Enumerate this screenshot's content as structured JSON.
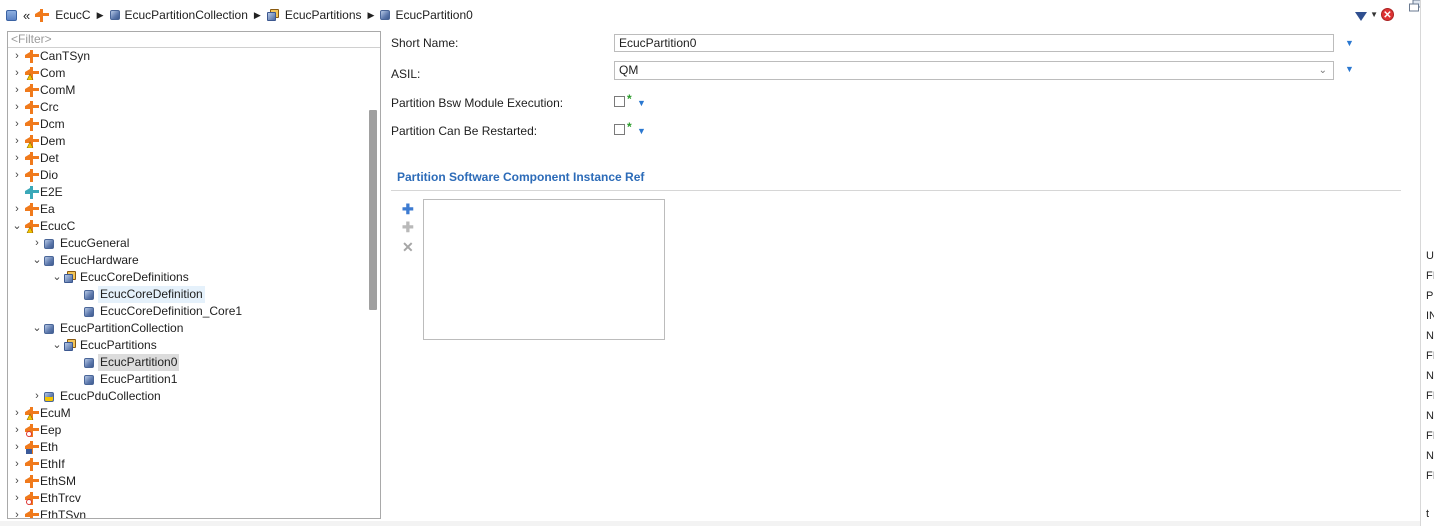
{
  "breadcrumb": {
    "items": [
      "EcucC",
      "EcucPartitionCollection",
      "EcucPartitions",
      "EcucPartition0"
    ],
    "back_symbol": "«",
    "separator": "▶",
    "close_symbol": "✕"
  },
  "tree": {
    "filter_placeholder": "<Filter>",
    "rows": [
      {
        "label": "CanTSyn",
        "level": 0,
        "icon": "module-icon",
        "toggle": "›"
      },
      {
        "label": "Com",
        "level": 0,
        "icon": "module-warning-icon",
        "toggle": "›"
      },
      {
        "label": "ComM",
        "level": 0,
        "icon": "module-icon",
        "toggle": "›"
      },
      {
        "label": "Crc",
        "level": 0,
        "icon": "module-icon",
        "toggle": "›"
      },
      {
        "label": "Dcm",
        "level": 0,
        "icon": "module-icon",
        "toggle": "›"
      },
      {
        "label": "Dem",
        "level": 0,
        "icon": "module-warning-icon",
        "toggle": "›"
      },
      {
        "label": "Det",
        "level": 0,
        "icon": "module-icon",
        "toggle": "›"
      },
      {
        "label": "Dio",
        "level": 0,
        "icon": "module-icon",
        "toggle": "›"
      },
      {
        "label": "E2E",
        "level": 0,
        "icon": "module-teal-icon",
        "toggle": ""
      },
      {
        "label": "Ea",
        "level": 0,
        "icon": "module-icon",
        "toggle": "›"
      },
      {
        "label": "EcucC",
        "level": 0,
        "icon": "module-warning-icon",
        "toggle": "⌄"
      },
      {
        "label": "EcucGeneral",
        "level": 1,
        "icon": "container-icon",
        "toggle": "›"
      },
      {
        "label": "EcucHardware",
        "level": 1,
        "icon": "container-icon",
        "toggle": "⌄"
      },
      {
        "label": "EcucCoreDefinitions",
        "level": 2,
        "icon": "collection-icon",
        "toggle": "⌄"
      },
      {
        "label": "EcucCoreDefinition",
        "level": 3,
        "icon": "container-icon",
        "toggle": "",
        "state": "hl"
      },
      {
        "label": "EcucCoreDefinition_Core1",
        "level": 3,
        "icon": "container-icon",
        "toggle": ""
      },
      {
        "label": "EcucPartitionCollection",
        "level": 1,
        "icon": "container-icon",
        "toggle": "⌄"
      },
      {
        "label": "EcucPartitions",
        "level": 2,
        "icon": "collection-icon",
        "toggle": "⌄"
      },
      {
        "label": "EcucPartition0",
        "level": 3,
        "icon": "container-icon",
        "toggle": "",
        "state": "sel"
      },
      {
        "label": "EcucPartition1",
        "level": 3,
        "icon": "container-icon",
        "toggle": ""
      },
      {
        "label": "EcucPduCollection",
        "level": 1,
        "icon": "container-warning-icon",
        "toggle": "›"
      },
      {
        "label": "EcuM",
        "level": 0,
        "icon": "module-warning-icon",
        "toggle": "›"
      },
      {
        "label": "Eep",
        "level": 0,
        "icon": "module-error-icon",
        "toggle": "›"
      },
      {
        "label": "Eth",
        "level": 0,
        "icon": "module-lock-icon",
        "toggle": "›"
      },
      {
        "label": "EthIf",
        "level": 0,
        "icon": "module-icon",
        "toggle": "›"
      },
      {
        "label": "EthSM",
        "level": 0,
        "icon": "module-icon",
        "toggle": "›"
      },
      {
        "label": "EthTrcv",
        "level": 0,
        "icon": "module-error-icon",
        "toggle": "›"
      },
      {
        "label": "EthTSyn",
        "level": 0,
        "icon": "module-icon",
        "toggle": "›"
      }
    ]
  },
  "detail": {
    "short_name_label": "Short Name:",
    "short_name_value": "EcucPartition0",
    "asil_label": "ASIL:",
    "asil_value": "QM",
    "bsw_exec_label": "Partition Bsw Module Execution:",
    "restart_label": "Partition Can Be Restarted:",
    "star": "*",
    "section_title": "Partition Software Component Instance Ref",
    "add_symbol": "✚",
    "remove_symbol": "✕"
  },
  "right_strip": {
    "chars": [
      "U",
      "FI",
      "PU",
      "IN",
      "N",
      "FI",
      "N",
      "FI",
      "N",
      "FI",
      "N",
      "FI",
      "t"
    ]
  },
  "colors": {
    "section_title": "#2c6bb8",
    "selection": "#dcdcdc",
    "highlight": "#e5f1fb",
    "star_green": "#2a9a2a",
    "dropdown_blue": "#2b78d0"
  }
}
